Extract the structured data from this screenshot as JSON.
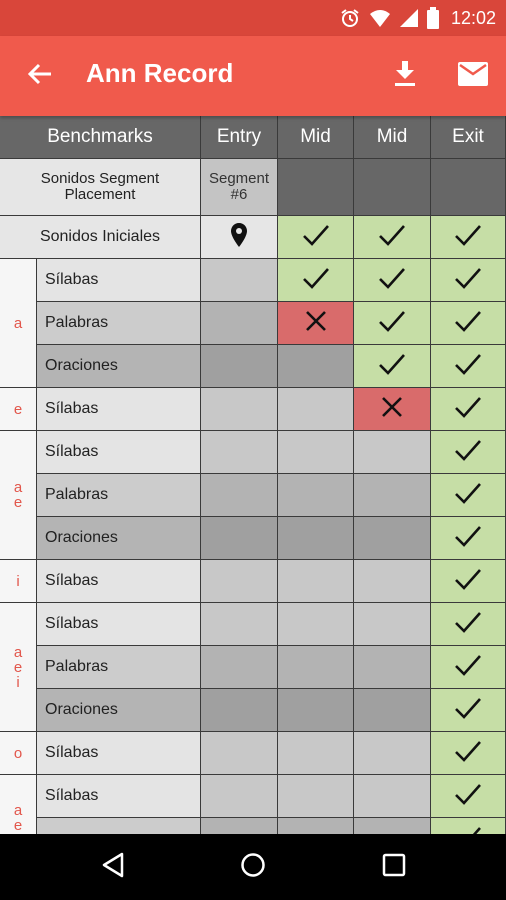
{
  "status_bar": {
    "time": "12:02",
    "icons": [
      "alarm-icon",
      "wifi-icon",
      "signal-icon",
      "battery-icon"
    ]
  },
  "app_bar": {
    "title": "Ann Record",
    "back_icon": "arrow-back-icon",
    "actions": [
      "download-icon",
      "mail-icon"
    ]
  },
  "colors": {
    "status_bar": "#d9463a",
    "app_bar": "#f05a4c",
    "pass": "#c6dea6",
    "fail": "#d96b6b",
    "header": "#676767",
    "group_letter": "#e2574c"
  },
  "table": {
    "headers": [
      "Benchmarks",
      "Entry",
      "Mid",
      "Mid",
      "Exit"
    ],
    "placement": {
      "label": "Sonidos Segment Placement",
      "entry": "Segment #6"
    },
    "iniciales": {
      "label": "Sonidos Iniciales",
      "entry_icon": "location-pin-icon",
      "marks": [
        "check",
        "check",
        "check"
      ]
    },
    "groups": [
      {
        "letters": [
          "a"
        ],
        "rows": [
          {
            "label": "Sílabas",
            "marks": [
              "check",
              "check",
              "check"
            ]
          },
          {
            "label": "Palabras",
            "marks": [
              "cross",
              "check",
              "check"
            ]
          },
          {
            "label": "Oraciones",
            "marks": [
              "",
              "check",
              "check"
            ]
          }
        ]
      },
      {
        "letters": [
          "e"
        ],
        "rows": [
          {
            "label": "Sílabas",
            "marks": [
              "",
              "cross",
              "check"
            ]
          }
        ]
      },
      {
        "letters": [
          "a",
          "e"
        ],
        "rows": [
          {
            "label": "Sílabas",
            "marks": [
              "",
              "",
              "check"
            ]
          },
          {
            "label": "Palabras",
            "marks": [
              "",
              "",
              "check"
            ]
          },
          {
            "label": "Oraciones",
            "marks": [
              "",
              "",
              "check"
            ]
          }
        ]
      },
      {
        "letters": [
          "i"
        ],
        "rows": [
          {
            "label": "Sílabas",
            "marks": [
              "",
              "",
              "check"
            ]
          }
        ]
      },
      {
        "letters": [
          "a",
          "e",
          "i"
        ],
        "rows": [
          {
            "label": "Sílabas",
            "marks": [
              "",
              "",
              "check"
            ]
          },
          {
            "label": "Palabras",
            "marks": [
              "",
              "",
              "check"
            ]
          },
          {
            "label": "Oraciones",
            "marks": [
              "",
              "",
              "check"
            ]
          }
        ]
      },
      {
        "letters": [
          "o"
        ],
        "rows": [
          {
            "label": "Sílabas",
            "marks": [
              "",
              "",
              "check"
            ]
          }
        ]
      },
      {
        "letters": [
          "a",
          "e"
        ],
        "rows": [
          {
            "label": "Sílabas",
            "marks": [
              "",
              "",
              "check"
            ]
          },
          {
            "label": "",
            "marks": [
              "",
              "",
              "check"
            ]
          }
        ]
      }
    ]
  },
  "nav_bar": {
    "buttons": [
      "back-triangle-icon",
      "home-circle-icon",
      "recents-square-icon"
    ]
  }
}
